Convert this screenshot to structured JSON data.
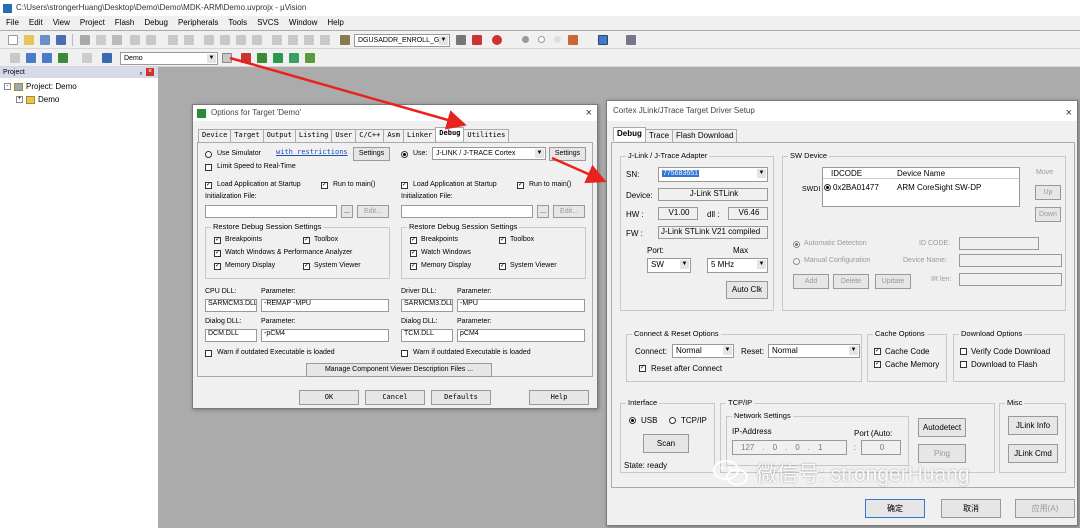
{
  "window": {
    "title": "C:\\Users\\strongerHuang\\Desktop\\Demo\\Demo\\MDK-ARM\\Demo.uvprojx - µVision"
  },
  "menu": [
    "File",
    "Edit",
    "View",
    "Project",
    "Flash",
    "Debug",
    "Peripherals",
    "Tools",
    "SVCS",
    "Window",
    "Help"
  ],
  "toolbar": {
    "combo1": "DGUSADDR_ENROLL_GEI",
    "target": "Demo"
  },
  "project_panel": {
    "title": "Project",
    "root": "Project: Demo",
    "child": "Demo"
  },
  "options": {
    "title": "Options for Target 'Demo'",
    "tabs": [
      "Device",
      "Target",
      "Output",
      "Listing",
      "User",
      "C/C++",
      "Asm",
      "Linker",
      "Debug",
      "Utilities"
    ],
    "left": {
      "use_sim": "Use Simulator",
      "with_restrictions": "with restrictions",
      "settings": "Settings",
      "limit_speed": "Limit Speed to Real-Time",
      "load_app": "Load Application at Startup",
      "run_main": "Run to main()",
      "init_file": "Initialization File:",
      "edit": "Edit...",
      "restore": "Restore Debug Session Settings",
      "bp": "Breakpoints",
      "toolbox": "Toolbox",
      "watch": "Watch Windows & Performance Analyzer",
      "mem": "Memory Display",
      "sysview": "System Viewer",
      "cpu_dll": "CPU DLL:",
      "param": "Parameter:",
      "cpu_dll_val": "SARMCM3.DLL",
      "cpu_param_val": "-REMAP -MPU",
      "dialog_dll": "Dialog DLL:",
      "dialog_dll_val": "DCM.DLL",
      "dialog_param_val": "-pCM4",
      "warn": "Warn if outdated Executable is loaded"
    },
    "right": {
      "use": "Use:",
      "driver": "J-LINK / J-TRACE Cortex",
      "settings": "Settings",
      "load_app": "Load Application at Startup",
      "run_main": "Run to main()",
      "init_file": "Initialization File:",
      "edit": "Edit...",
      "restore": "Restore Debug Session Settings",
      "bp": "Breakpoints",
      "toolbox": "Toolbox",
      "watch": "Watch Windows",
      "mem": "Memory Display",
      "sysview": "System Viewer",
      "driver_dll": "Driver DLL:",
      "param": "Parameter:",
      "driver_dll_val": "SARMCM3.DLL",
      "driver_param_val": "-MPU",
      "dialog_dll": "Dialog DLL:",
      "dialog_dll_val": "TCM.DLL",
      "dialog_param_val": "pCM4",
      "warn": "Warn if outdated Executable is loaded"
    },
    "manage": "Manage Component Viewer Description Files ...",
    "ok": "OK",
    "cancel": "Cancel",
    "defaults": "Defaults",
    "help": "Help"
  },
  "jlink": {
    "title": "Cortex JLink/JTrace Target Driver Setup",
    "tabs": [
      "Debug",
      "Trace",
      "Flash Download"
    ],
    "adapter": {
      "label": "J-Link / J-Trace Adapter",
      "sn_label": "SN:",
      "sn": "775683651",
      "device_label": "Device:",
      "device": "J-Link STLink",
      "hw_label": "HW :",
      "hw": "V1.00",
      "dll_label": "dll :",
      "dll": "V6.46",
      "fw_label": "FW :",
      "fw": "J-Link STLink V21 compiled",
      "port_label": "Port:",
      "port": "SW",
      "max_label": "Max",
      "max": "5 MHz",
      "auto_clk": "Auto Clk"
    },
    "sw": {
      "label": "SW Device",
      "swdi": "SWDI",
      "col_id": "IDCODE",
      "col_name": "Device Name",
      "id": "0x2BA01477",
      "name": "ARM CoreSight SW-DP",
      "move": "Move",
      "up": "Up",
      "down": "Down",
      "auto_det": "Automatic Detection",
      "manual": "Manual Configuration",
      "id_code": "ID CODE:",
      "dev_name": "Device Name:",
      "ir_len": "IR len:",
      "add": "Add",
      "delete": "Delete",
      "update": "Update"
    },
    "connect": {
      "label": "Connect & Reset Options",
      "connect_label": "Connect:",
      "connect_val": "Normal",
      "reset_label": "Reset:",
      "reset_val": "Normal",
      "reset_after": "Reset after Connect"
    },
    "cache": {
      "label": "Cache Options",
      "code": "Cache Code",
      "memory": "Cache Memory"
    },
    "download": {
      "label": "Download Options",
      "verify": "Verify Code Download",
      "to_flash": "Download to Flash"
    },
    "interface": {
      "label": "Interface",
      "usb": "USB",
      "tcpip": "TCP/IP",
      "scan": "Scan",
      "state": "State: ready"
    },
    "tcpip": {
      "label": "TCP/IP",
      "net": "Network Settings",
      "ip_label": "IP-Address",
      "ip": [
        "127",
        "0",
        "0",
        "1"
      ],
      "port_label": "Port (Auto:",
      "port": "0",
      "autodetect": "Autodetect",
      "ping": "Ping"
    },
    "misc": {
      "label": "Misc",
      "info": "JLink Info",
      "cmd": "JLink Cmd"
    },
    "ok": "确定",
    "cancel": "取消",
    "apply": "应用(A)"
  },
  "watermark": "微信号: strongerHuang",
  "colors": {
    "arrow": "#e8221c",
    "selection": "#3377d6"
  }
}
